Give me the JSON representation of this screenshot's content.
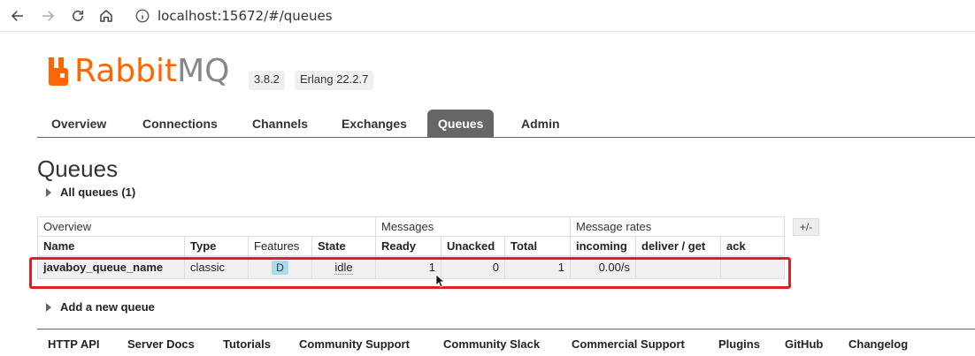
{
  "browser": {
    "url": "localhost:15672/#/queues"
  },
  "logo": {
    "rabbit": "Rabbit",
    "mq": "MQ",
    "version": "3.8.2",
    "erlang": "Erlang 22.2.7"
  },
  "tabs": [
    {
      "label": "Overview"
    },
    {
      "label": "Connections"
    },
    {
      "label": "Channels"
    },
    {
      "label": "Exchanges"
    },
    {
      "label": "Queues"
    },
    {
      "label": "Admin"
    }
  ],
  "page": {
    "title": "Queues",
    "all_queues": "All queues (1)",
    "add_queue": "Add a new queue",
    "plus_minus": "+/-"
  },
  "table": {
    "groups": {
      "overview": "Overview",
      "messages": "Messages",
      "rates": "Message rates"
    },
    "columns": {
      "name": "Name",
      "type": "Type",
      "features": "Features",
      "state": "State",
      "ready": "Ready",
      "unacked": "Unacked",
      "total": "Total",
      "incoming": "incoming",
      "deliver": "deliver / get",
      "ack": "ack"
    },
    "row": {
      "name": "javaboy_queue_name",
      "type": "classic",
      "features": "D",
      "state": "idle",
      "ready": "1",
      "unacked": "0",
      "total": "1",
      "incoming": "0.00/s",
      "deliver": "",
      "ack": ""
    }
  },
  "footer": [
    {
      "label": "HTTP API"
    },
    {
      "label": "Server Docs"
    },
    {
      "label": "Tutorials"
    },
    {
      "label": "Community Support"
    },
    {
      "label": "Community Slack"
    },
    {
      "label": "Commercial Support"
    },
    {
      "label": "Plugins"
    },
    {
      "label": "GitHub"
    },
    {
      "label": "Changelog"
    }
  ],
  "colors": {
    "brand_orange": "#ff6600",
    "active_tab": "#666666",
    "highlight": "#e02020"
  }
}
